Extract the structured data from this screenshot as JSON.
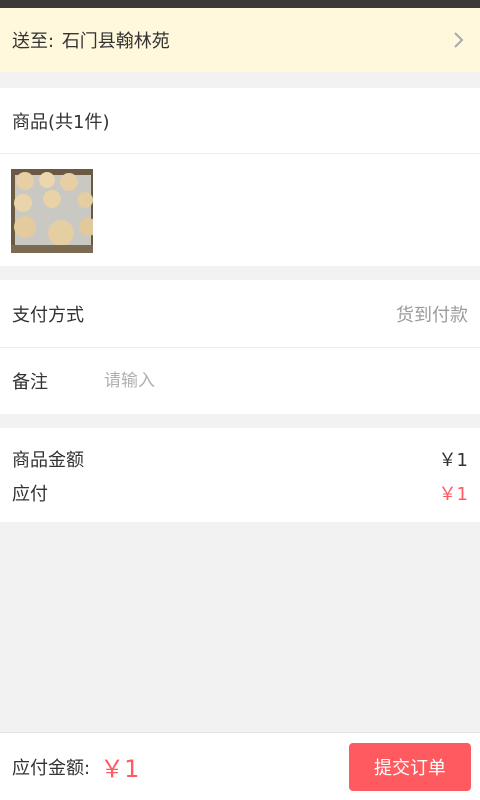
{
  "address": {
    "label": "送至:",
    "value": "石门县翰林苑"
  },
  "goods": {
    "header": "商品(共1件)",
    "items": [
      {
        "thumbnail": "steamed-buns-photo"
      }
    ]
  },
  "payment": {
    "label": "支付方式",
    "value": "货到付款"
  },
  "remark": {
    "label": "备注",
    "placeholder": "请输入",
    "value": ""
  },
  "amounts": {
    "goods_amount_label": "商品金额",
    "goods_amount_value": "￥1",
    "payable_label": "应付",
    "payable_value": "￥1"
  },
  "bottom": {
    "label": "应付金额:",
    "total": "￥1",
    "submit_label": "提交订单"
  },
  "colors": {
    "accent": "#ff5a5f",
    "address_bg": "#fff8dd",
    "page_bg": "#f2f2f2"
  },
  "icons": {
    "address_arrow": "chevron-right-icon"
  }
}
